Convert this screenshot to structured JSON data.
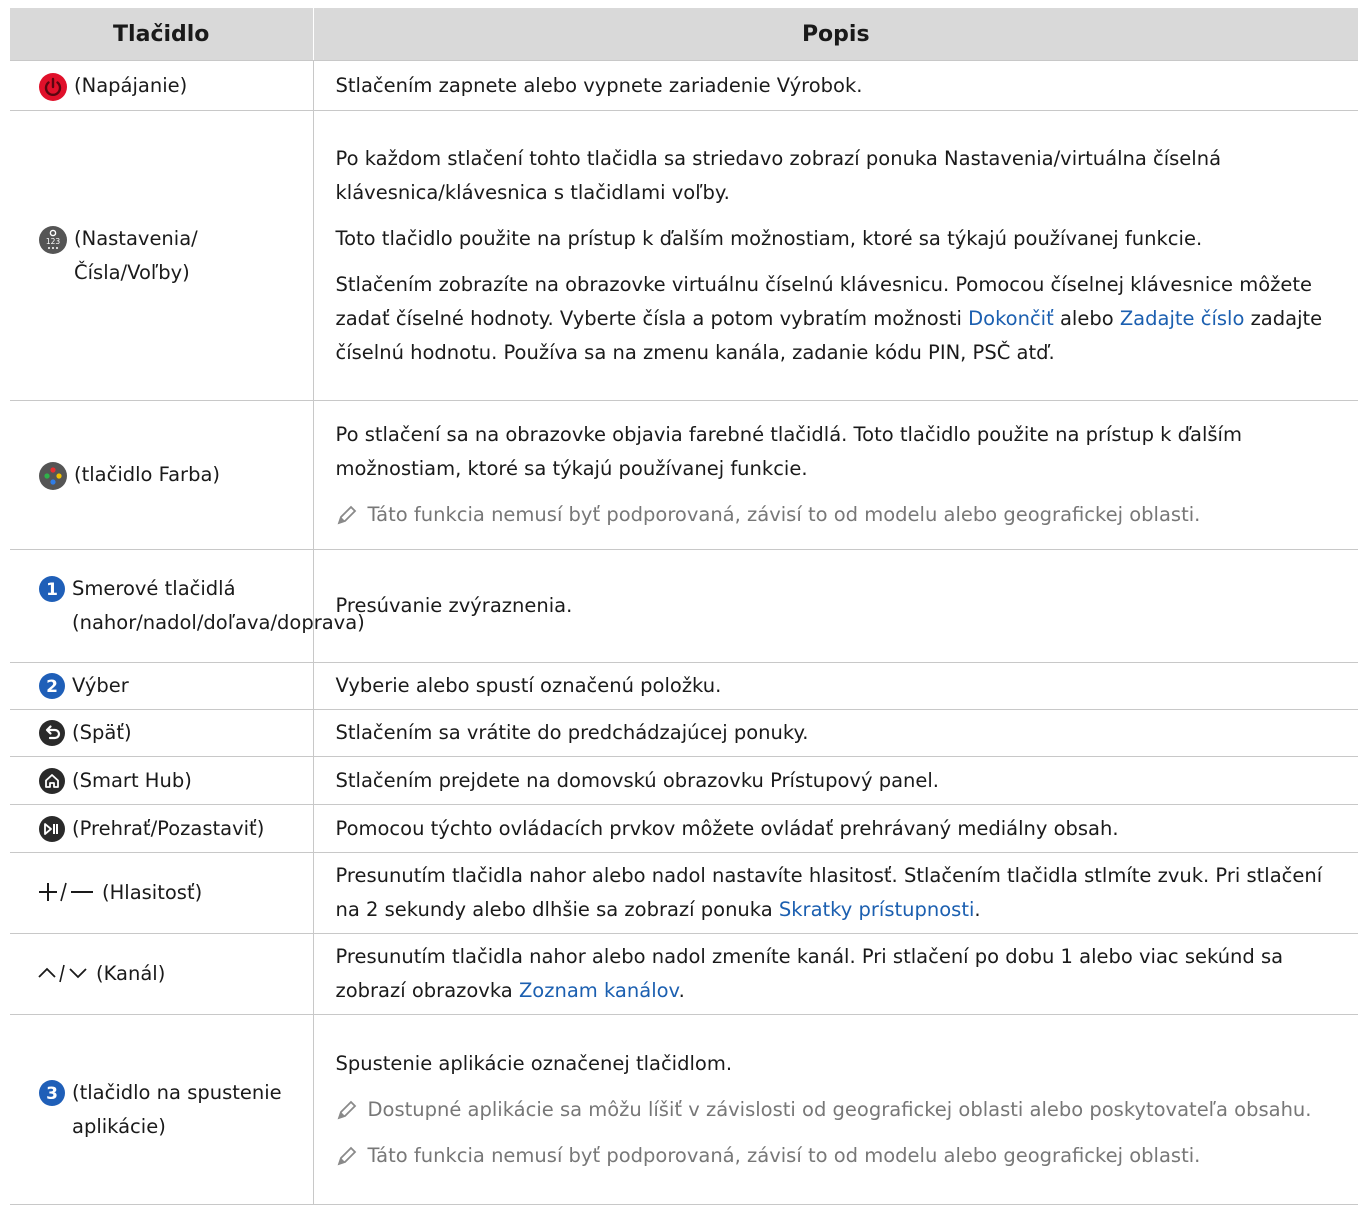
{
  "table": {
    "headers": [
      "Tlačidlo",
      "Popis"
    ],
    "rows": [
      {
        "icon": "power-icon",
        "button": "(Napájanie)",
        "desc": [
          {
            "text": "Stlačením zapnete alebo vypnete zariadenie Výrobok."
          }
        ]
      },
      {
        "icon": "settings-numbers-icon",
        "button": "(Nastavenia/Čísla/Voľby)",
        "desc": [
          {
            "text": "Po každom stlačení tohto tlačidla sa striedavo zobrazí ponuka Nastavenia/virtuálna číselná klávesnica/klávesnica s tlačidlami voľby."
          },
          {
            "text": "Toto tlačidlo použite na prístup k ďalším možnostiam, ktoré sa týkajú používanej funkcie."
          },
          {
            "t1": "Stlačením zobrazíte na obrazovke virtuálnu číselnú klávesnicu. Pomocou číselnej klávesnice môžete zadať číselné hodnoty. Vyberte čísla a potom vybratím možnosti ",
            "link1": "Dokončiť",
            "t2": " alebo ",
            "link2": "Zadajte číslo",
            "t3": " zadajte číselnú hodnotu. Používa sa na zmenu kanála, zadanie kódu PIN, PSČ atď."
          }
        ]
      },
      {
        "icon": "color-button-icon",
        "button": "(tlačidlo Farba)",
        "desc": [
          {
            "text": "Po stlačení sa na obrazovke objavia farebné tlačidlá. Toto tlačidlo použite na prístup k ďalším možnostiam, ktoré sa týkajú používanej funkcie."
          }
        ],
        "notes": [
          "Táto funkcia nemusí byť podporovaná, závisí to od modelu alebo geografickej oblasti."
        ]
      },
      {
        "icon": "number-1-icon",
        "icon_text": "1",
        "button": "Smerové tlačidlá (nahor/nadol/doľava/doprava)",
        "desc": [
          {
            "text": "Presúvanie zvýraznenia."
          }
        ]
      },
      {
        "icon": "number-2-icon",
        "icon_text": "2",
        "button": "Výber",
        "desc": [
          {
            "text": "Vyberie alebo spustí označenú položku."
          }
        ]
      },
      {
        "icon": "back-icon",
        "button": "(Späť)",
        "desc": [
          {
            "text": "Stlačením sa vrátite do predchádzajúcej ponuky."
          }
        ]
      },
      {
        "icon": "home-icon",
        "button": "(Smart Hub)",
        "desc": [
          {
            "text": "Stlačením prejdete na domovskú obrazovku Prístupový panel."
          }
        ]
      },
      {
        "icon": "play-pause-icon",
        "button": "(Prehrať/Pozastaviť)",
        "desc": [
          {
            "text": "Pomocou týchto ovládacích prvkov môžete ovládať prehrávaný mediálny obsah."
          }
        ]
      },
      {
        "icon": "volume-plus-minus-icon",
        "button": "(Hlasitosť)",
        "desc": [
          {
            "t1": "Presunutím tlačidla nahor alebo nadol nastavíte hlasitosť. Stlačením tlačidla stlmíte zvuk. Pri stlačení na 2 sekundy alebo dlhšie sa zobrazí ponuka ",
            "link1": "Skratky prístupnosti",
            "t2": "."
          }
        ]
      },
      {
        "icon": "channel-up-down-icon",
        "button": "(Kanál)",
        "desc": [
          {
            "t1": "Presunutím tlačidla nahor alebo nadol zmeníte kanál. Pri stlačení po dobu 1 alebo viac sekúnd sa zobrazí obrazovka ",
            "link1": "Zoznam kanálov",
            "t2": "."
          }
        ]
      },
      {
        "icon": "number-3-icon",
        "icon_text": "3",
        "button": "(tlačidlo na spustenie aplikácie)",
        "desc": [
          {
            "text": "Spustenie aplikácie označenej tlačidlom."
          }
        ],
        "notes": [
          "Dostupné aplikácie sa môžu líšiť v závislosti od geografickej oblasti alebo poskytovateľa obsahu.",
          "Táto funkcia nemusí byť podporovaná, závisí to od modelu alebo geografickej oblasti."
        ]
      }
    ]
  },
  "colors": {
    "link": "#1b5fb0",
    "header_bg": "#d9d9d9",
    "power_red": "#e0102a",
    "badge_blue": "#1f5fb8",
    "note_gray": "#777777"
  }
}
